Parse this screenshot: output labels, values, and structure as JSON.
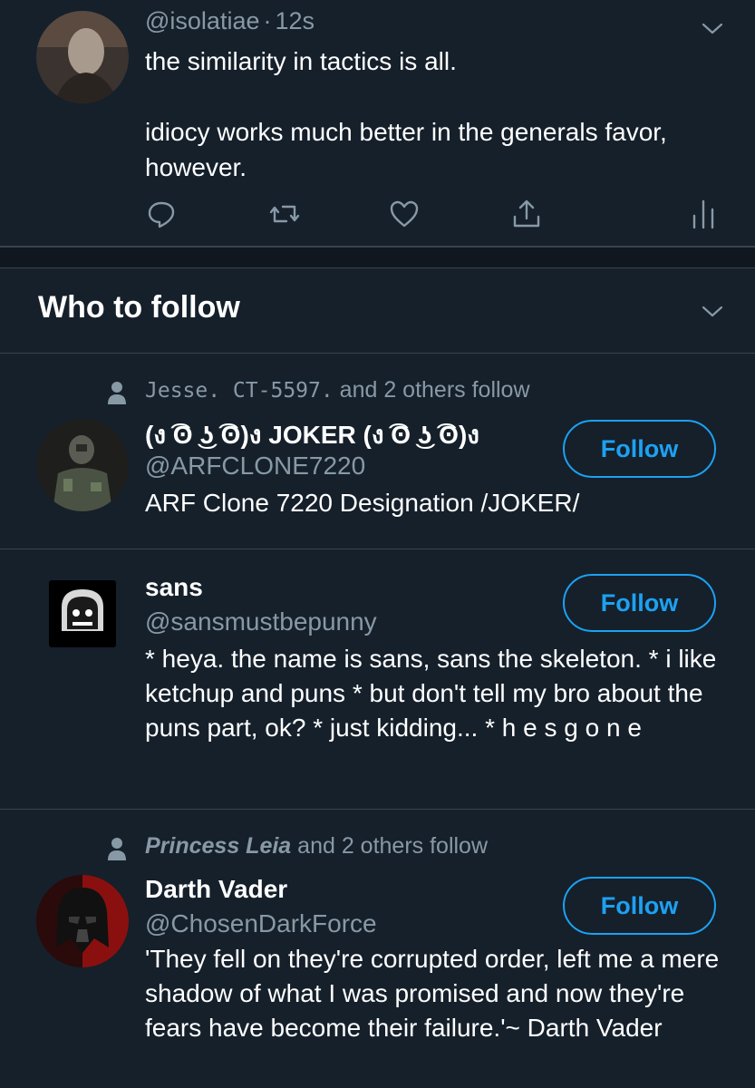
{
  "tweet": {
    "handle": "@isolatiae",
    "separator": "·",
    "time": "12s",
    "text": "the similarity in tactics is all.\n\nidiocy works much better in the generals favor, however."
  },
  "who_to_follow": {
    "title": "Who to follow",
    "suggestions": [
      {
        "social_mono": "Jesse. CT-5597.",
        "social_rest": " and 2 others follow",
        "name": "(ง ͡ʘ ͜ʖ ͡ʘ)ง JOKER (ง ͡ʘ ͜ʖ ͡ʘ)ง",
        "handle": "@ARFCLONE7220",
        "bio": "ARF Clone 7220 Designation /JOKER/",
        "follow_label": "Follow"
      },
      {
        "name": "sans",
        "handle": "@sansmustbepunny",
        "bio": "* heya. the name is sans, sans the skeleton. * i like ketchup and puns * but don't tell my bro about the puns part, ok? * just kidding... * h e s g o n e",
        "follow_label": "Follow"
      },
      {
        "social_bold": "Princess Leia",
        "social_rest": " and 2 others follow",
        "name": "Darth Vader",
        "handle": "@ChosenDarkForce",
        "bio": "'They fell on they're corrupted order, left me a mere shadow of what I was promised and now they're fears have become their failure.'~ Darth Vader",
        "follow_label": "Follow"
      }
    ]
  },
  "colors": {
    "background": "#15202b",
    "divider": "#38444d",
    "secondary_text": "#8899a6",
    "accent": "#1da1f2"
  },
  "icons": [
    "chevron-down-icon",
    "reply-icon",
    "retweet-icon",
    "like-icon",
    "share-icon",
    "analytics-icon",
    "person-icon"
  ]
}
